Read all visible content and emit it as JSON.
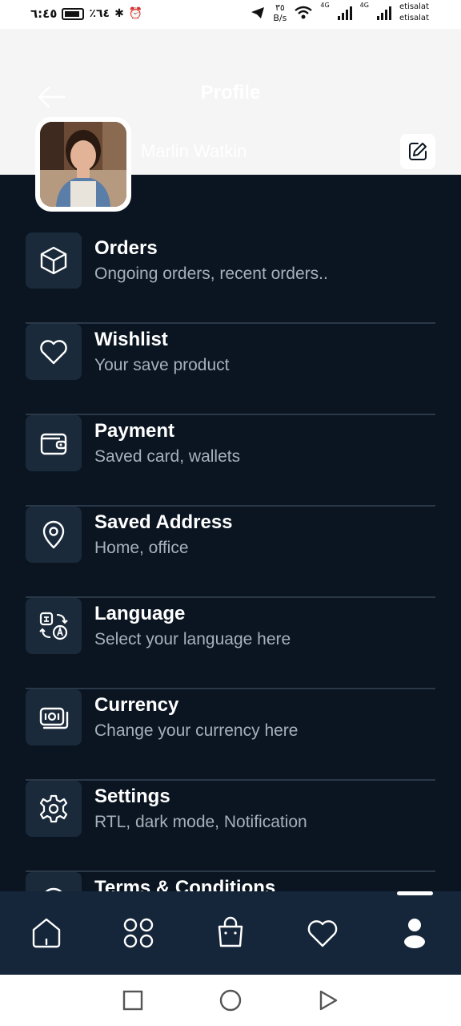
{
  "status_bar": {
    "time": "٦:٤٥",
    "battery": "٪٦٤",
    "speed_value": "٣٥",
    "speed_unit": "B/s",
    "carrier1": "etisalat",
    "carrier2": "etisalat",
    "net1": "4G",
    "net2": "4G"
  },
  "header": {
    "title": "Profile",
    "user_name": "Marlin Watkin"
  },
  "menu": [
    {
      "label": "Orders",
      "sub": "Ongoing orders, recent orders..",
      "icon": "box-icon"
    },
    {
      "label": "Wishlist",
      "sub": "Your save product",
      "icon": "heart-icon"
    },
    {
      "label": "Payment",
      "sub": "Saved card, wallets",
      "icon": "wallet-icon"
    },
    {
      "label": "Saved Address",
      "sub": "Home, office",
      "icon": "location-pin-icon"
    },
    {
      "label": "Language",
      "sub": "Select your language here",
      "icon": "translate-icon"
    },
    {
      "label": "Currency",
      "sub": "Change your currency here",
      "icon": "money-icon"
    },
    {
      "label": "Settings",
      "sub": "RTL, dark mode, Notification",
      "icon": "gear-icon"
    },
    {
      "label": "Terms & Conditions",
      "sub": "",
      "icon": "info-icon"
    }
  ],
  "bottom_nav": {
    "items": [
      "home-icon",
      "categories-icon",
      "bag-icon",
      "heart-icon",
      "profile-icon"
    ],
    "active": "profile-icon"
  },
  "colors": {
    "background": "#0a1521",
    "icon_box": "#1a2a3a",
    "divider": "#2a3847",
    "nav_bg": "#16263a",
    "subtext": "#a7b0ba"
  }
}
